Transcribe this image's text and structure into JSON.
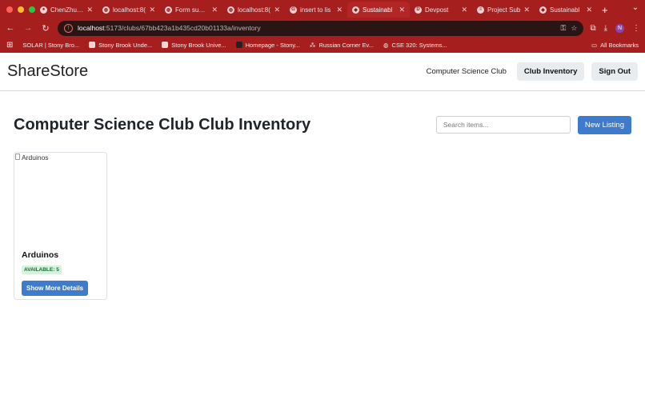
{
  "browser": {
    "tabs": [
      {
        "label": "ChenZhu50",
        "icon": "github-icon"
      },
      {
        "label": "localhost:8(",
        "icon": "globe-icon"
      },
      {
        "label": "Form submi",
        "icon": "globe-icon"
      },
      {
        "label": "localhost:8(",
        "icon": "globe-icon"
      },
      {
        "label": "insert to lis",
        "icon": "google-icon"
      },
      {
        "label": "Sustainabl",
        "icon": "gem-icon"
      },
      {
        "label": "Devpost",
        "icon": "devpost-icon"
      },
      {
        "label": "Project Sub",
        "icon": "form-icon"
      },
      {
        "label": "Sustainabl",
        "icon": "gem-icon"
      }
    ],
    "url_host": "localhost",
    "url_path": ":5173/clubs/67bb423a1b435cd20b01133a/inventory",
    "profile_initial": "N",
    "bookmarks": [
      "SOLAR | Stony Bro...",
      "Stony Brook Unde...",
      "Stony Brook Unive...",
      "Homepage - Stony...",
      "Russian Corner Ev...",
      "CSE 320: Systems..."
    ],
    "all_bookmarks": "All Bookmarks"
  },
  "header": {
    "brand": "ShareStore",
    "club_link": "Computer Science Club",
    "inventory_btn": "Club Inventory",
    "signout_btn": "Sign Out"
  },
  "page": {
    "club_name": "Computer Science Club",
    "title_suffix": "Club Inventory",
    "search_placeholder": "Search items...",
    "new_listing": "New Listing"
  },
  "items": [
    {
      "image_alt": "Arduinos",
      "name": "Arduinos",
      "availability": "AVAILABLE: 5",
      "details_btn": "Show More Details"
    }
  ],
  "colors": {
    "browser_chrome": "#a61e1e",
    "primary_button": "#3f7bcc",
    "badge_bg": "#d4f2dd",
    "badge_text": "#1c6b32"
  }
}
